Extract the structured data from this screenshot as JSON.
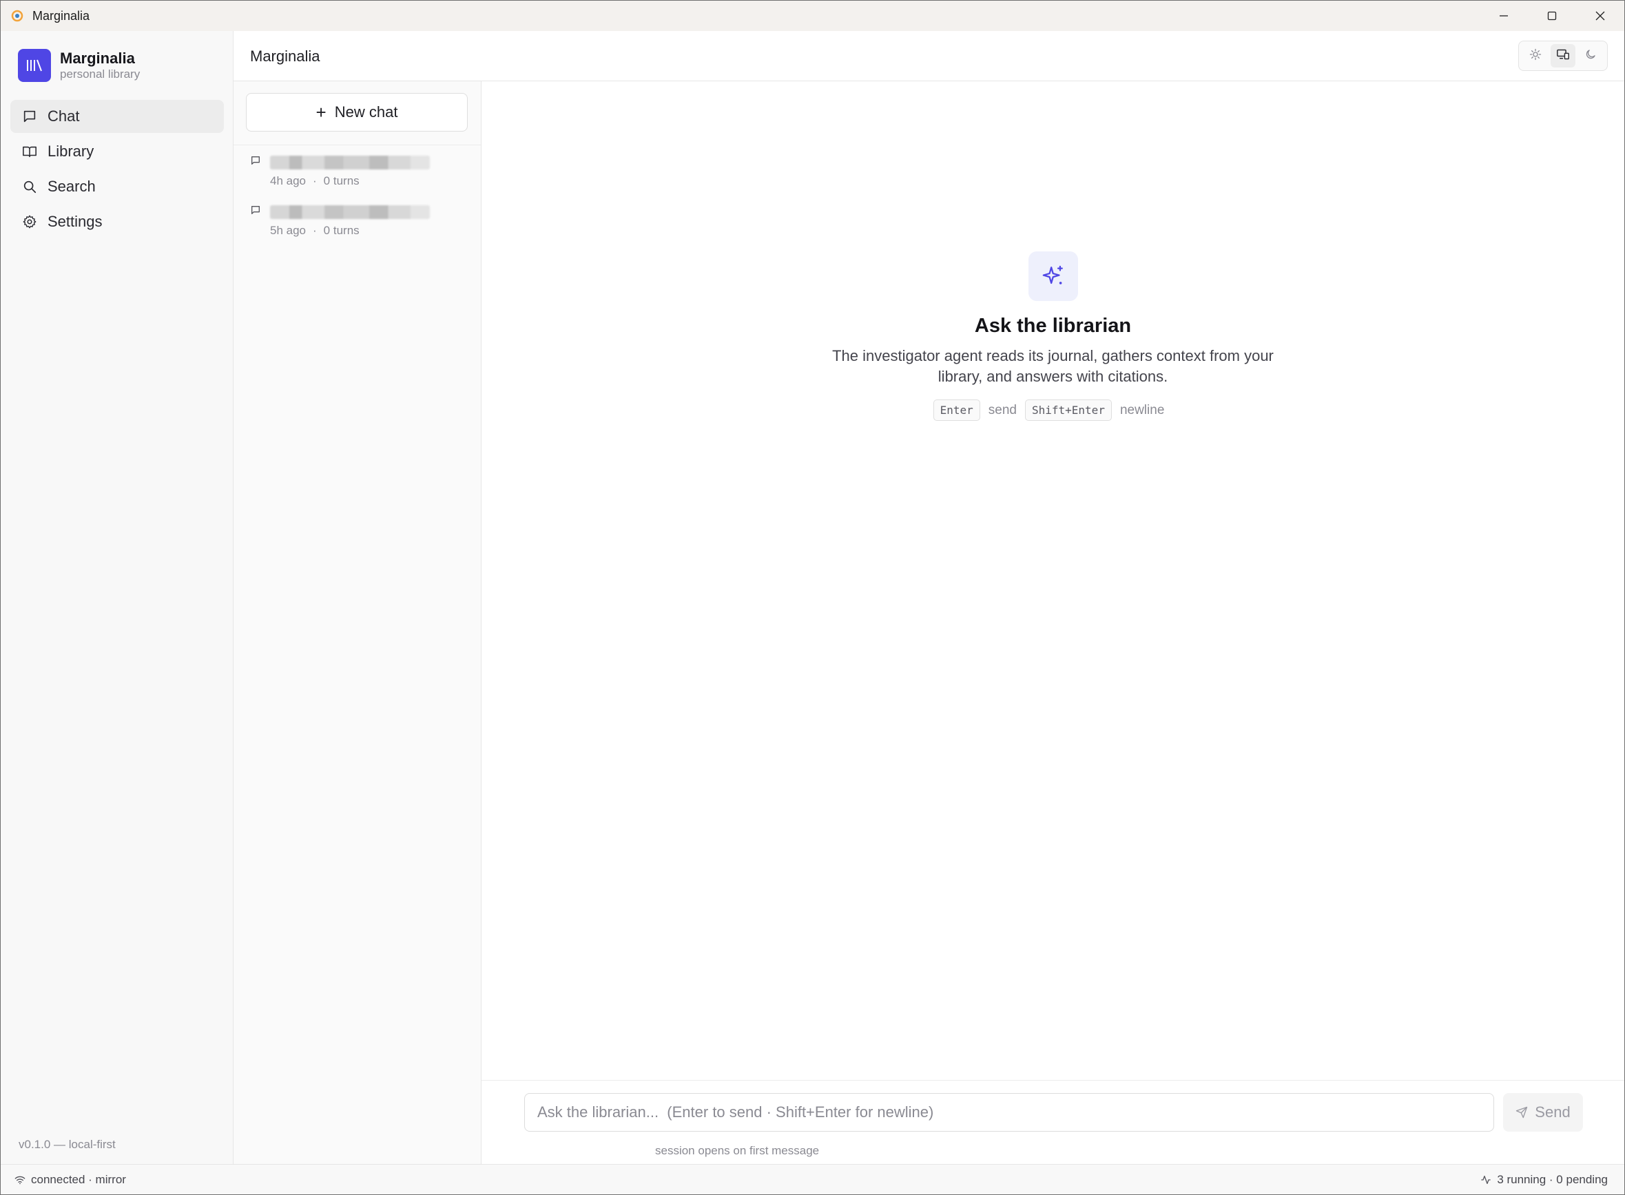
{
  "window": {
    "title": "Marginalia"
  },
  "brand": {
    "name": "Marginalia",
    "subtitle": "personal library",
    "color": "#4f46e5"
  },
  "nav": {
    "items": [
      {
        "label": "Chat",
        "icon": "message-square-icon",
        "active": true
      },
      {
        "label": "Library",
        "icon": "book-open-icon",
        "active": false
      },
      {
        "label": "Search",
        "icon": "search-icon",
        "active": false
      },
      {
        "label": "Settings",
        "icon": "gear-icon",
        "active": false
      }
    ]
  },
  "version": "v0.1.0 — local-first",
  "header": {
    "title": "Marginalia",
    "theme_options": [
      "sun-icon",
      "monitor-icon",
      "moon-icon"
    ],
    "active_theme": "monitor-icon"
  },
  "chat_list": {
    "new_chat_label": "New chat",
    "sessions": [
      {
        "time": "4h ago",
        "turns": "0 turns"
      },
      {
        "time": "5h ago",
        "turns": "0 turns"
      }
    ]
  },
  "empty_state": {
    "icon": "sparkles-icon",
    "title": "Ask the librarian",
    "description": "The investigator agent reads its journal, gathers context from your library, and answers with citations.",
    "hint_key_1": "Enter",
    "hint_text_1": "send",
    "hint_key_2": "Shift+Enter",
    "hint_text_2": "newline"
  },
  "composer": {
    "placeholder": "Ask the librarian...  (Enter to send · Shift+Enter for newline)",
    "send_label": "Send",
    "hint": "session opens on first message"
  },
  "status": {
    "left": "connected · mirror",
    "right": "3 running · 0 pending"
  }
}
